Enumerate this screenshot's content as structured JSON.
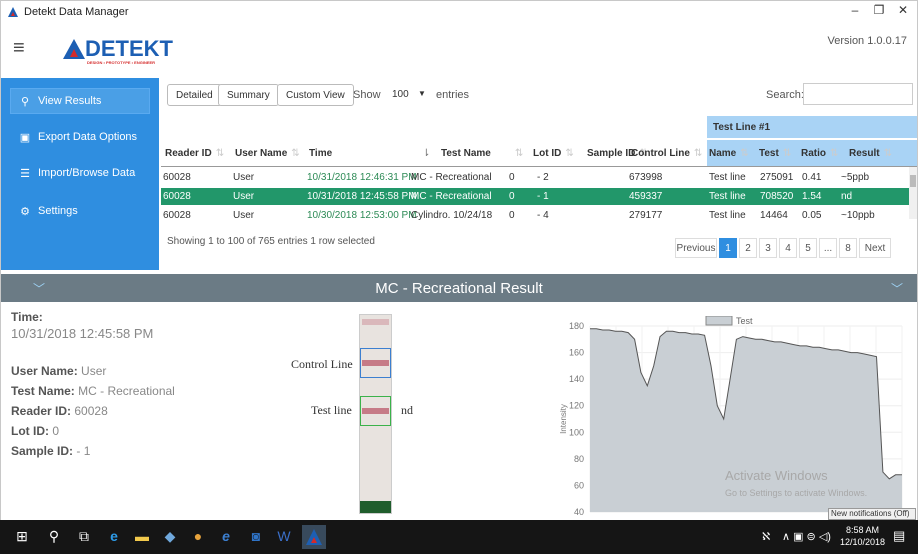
{
  "window": {
    "title": "Detekt Data Manager",
    "controls": [
      "–",
      "❐",
      "✕"
    ]
  },
  "header": {
    "brand_name": "DETEKT",
    "brand_tagline": "DESIGN • PROTOTYPE • ENGINEER",
    "version": "Version 1.0.0.17"
  },
  "sidebar": {
    "items": [
      {
        "label": "View Results",
        "icon": "search-icon",
        "active": true
      },
      {
        "label": "Export Data Options",
        "icon": "export-icon",
        "active": false
      },
      {
        "label": "Import/Browse Data",
        "icon": "database-icon",
        "active": false
      },
      {
        "label": "Settings",
        "icon": "gear-icon",
        "active": false
      }
    ]
  },
  "toolbar": {
    "detailed": "Detailed",
    "summary": "Summary",
    "custom_view": "Custom View",
    "show": "Show",
    "entries_value": "100",
    "entries": "entries",
    "search": "Search:"
  },
  "table": {
    "group_header": "Test Line #1",
    "columns": [
      "Reader ID",
      "User Name",
      "Time",
      "Test Name",
      "Lot ID",
      "Sample ID",
      "Control Line",
      "Name",
      "Test",
      "Ratio",
      "Result"
    ],
    "rows": [
      [
        "60028",
        "User",
        "10/31/2018 12:46:31 PM",
        "MC - Recreational",
        "0",
        "- 2",
        "673998",
        "Test line",
        "275091",
        "0.41",
        "~5ppb"
      ],
      [
        "60028",
        "User",
        "10/31/2018 12:45:58 PM",
        "MC - Recreational",
        "0",
        "- 1",
        "459337",
        "Test line",
        "708520",
        "1.54",
        "nd"
      ],
      [
        "60028",
        "User",
        "10/30/2018 12:53:00 PM",
        "Cylindro. 10/24/18",
        "0",
        "- 4",
        "279177",
        "Test line",
        "14464",
        "0.05",
        "~10ppb"
      ]
    ],
    "selected_row": 1,
    "info": "Showing 1 to 100 of 765 entries   1 row selected",
    "pagination": [
      "Previous",
      "1",
      "2",
      "3",
      "4",
      "5",
      "...",
      "8",
      "Next"
    ],
    "current_page": "1"
  },
  "result": {
    "banner_title": "MC - Recreational Result",
    "time_label": "Time:",
    "time_value": "10/31/2018 12:45:58 PM",
    "user_name_label": "User Name:",
    "user_name_value": "User",
    "test_name_label": "Test Name:",
    "test_name_value": "MC - Recreational",
    "reader_id_label": "Reader ID:",
    "reader_id_value": "60028",
    "lot_id_label": "Lot ID:",
    "lot_id_value": "0",
    "sample_id_label": "Sample ID:",
    "sample_id_value": "- 1",
    "strip_control_label": "Control Line",
    "strip_test_label": "Test line",
    "strip_test_result": "nd"
  },
  "chart_data": {
    "type": "area",
    "legend": [
      "Test"
    ],
    "ylabel": "Intensity",
    "ylim": [
      40,
      180
    ],
    "yticks": [
      40,
      60,
      80,
      100,
      120,
      140,
      160,
      180
    ],
    "series": [
      {
        "name": "Test",
        "values": [
          178,
          178,
          177,
          177,
          176,
          176,
          175,
          170,
          145,
          135,
          150,
          172,
          176,
          176,
          175,
          175,
          174,
          174,
          173,
          150,
          120,
          110,
          140,
          170,
          172,
          171,
          170,
          170,
          169,
          168,
          168,
          167,
          166,
          165,
          165,
          164,
          164,
          163,
          162,
          162,
          161,
          160,
          160,
          159,
          158,
          157,
          70,
          65,
          68,
          68
        ]
      }
    ],
    "fill_color": "#c9cfd4",
    "line_color": "#555555"
  },
  "watermark": {
    "line1": "Activate Windows",
    "line2": "Go to Settings to activate Windows."
  },
  "taskbar": {
    "notification": "New notifications (Off)",
    "time": "8:58 AM",
    "date": "12/10/2018"
  }
}
